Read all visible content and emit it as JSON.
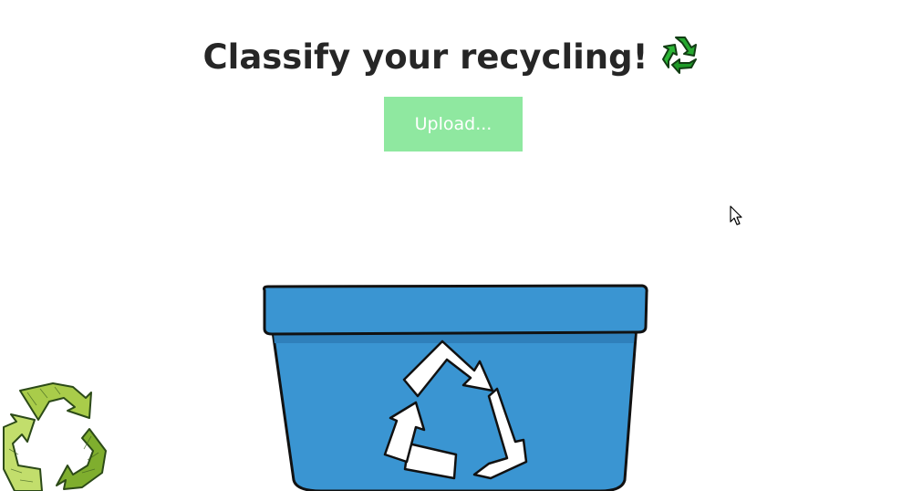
{
  "header": {
    "title": "Classify your recycling!",
    "title_icon": "recycle-emoji-icon"
  },
  "upload": {
    "label": "Upload..."
  },
  "illustrations": {
    "bin": "recycling-bin-illustration",
    "corner_logo": "recycle-sketch-icon"
  },
  "colors": {
    "title_text": "#262626",
    "upload_bg": "#8fe8a0",
    "upload_text": "#ffffff",
    "bin_blue": "#3a95d2",
    "recycle_green": "#22a32c"
  }
}
